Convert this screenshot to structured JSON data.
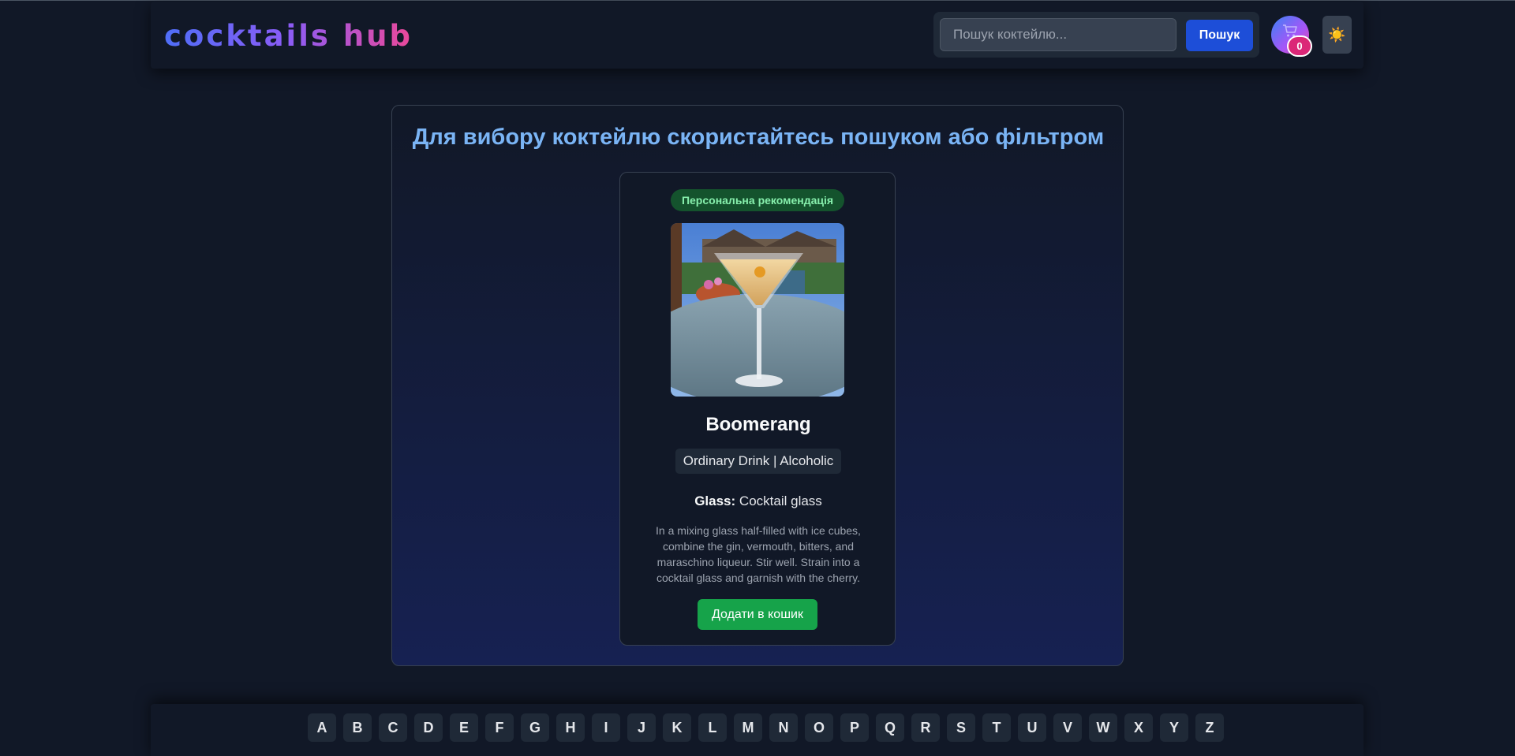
{
  "header": {
    "logo": "cocktails hub",
    "search": {
      "placeholder": "Пошук коктейлю...",
      "value": ""
    },
    "search_button": "Пошук",
    "cart_count": "0",
    "theme_icon": "☀️"
  },
  "main": {
    "title": "Для вибору коктейлю скористайтесь пошуком або фільтром",
    "card": {
      "badge": "Персональна рекомендація",
      "name": "Boomerang",
      "category": "Ordinary Drink | Alcoholic",
      "glass_label": "Glass:",
      "glass_value": "Cocktail glass",
      "instructions": "In a mixing glass half-filled with ice cubes, combine the gin, vermouth, bitters, and maraschino liqueur. Stir well. Strain into a cocktail glass and garnish with the cherry.",
      "add_button": "Додати в кошик"
    }
  },
  "alphabet": [
    "A",
    "B",
    "C",
    "D",
    "E",
    "F",
    "G",
    "H",
    "I",
    "J",
    "K",
    "L",
    "M",
    "N",
    "O",
    "P",
    "Q",
    "R",
    "S",
    "T",
    "U",
    "V",
    "W",
    "X",
    "Y",
    "Z"
  ],
  "icons": {
    "cart": "cart-icon",
    "theme": "sun-icon"
  },
  "colors": {
    "accent_blue": "#1d4ed8",
    "add_green": "#16a34a",
    "badge_pink": "#db2777",
    "title_blue": "#7ab4f5"
  }
}
